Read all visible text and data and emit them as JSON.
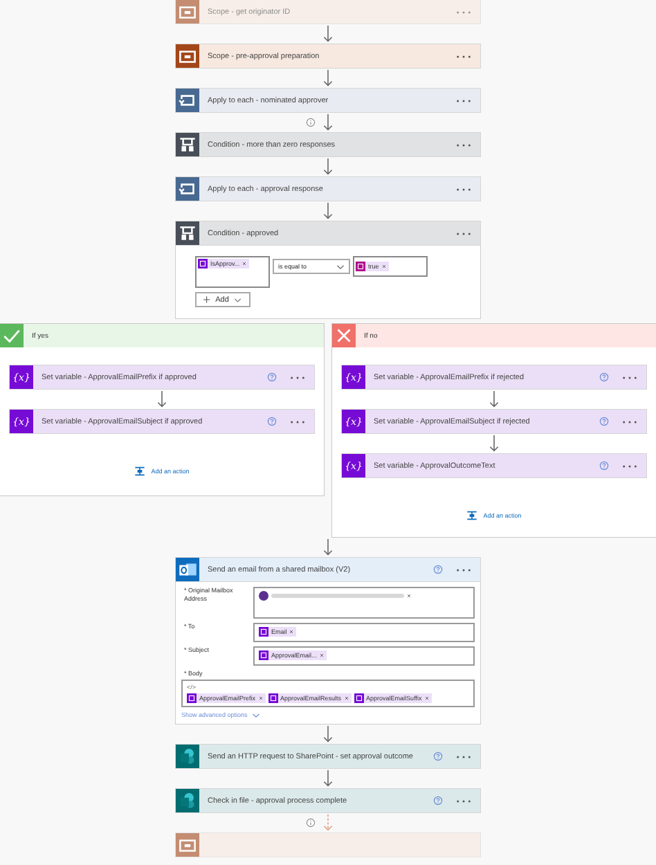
{
  "flow_top": [
    {
      "kind": "scope",
      "title": "Scope - get originator ID",
      "faded": true,
      "arrow": true
    },
    {
      "kind": "scope",
      "title": "Scope - pre-approval preparation",
      "faded": false,
      "arrow": true
    },
    {
      "kind": "foreach",
      "title": "Apply to each - nominated approver",
      "faded": false,
      "arrow": true,
      "info": true
    },
    {
      "kind": "condition",
      "title": "Condition - more than zero responses",
      "faded": false,
      "arrow": true
    },
    {
      "kind": "foreach",
      "title": "Apply to each - approval response",
      "faded": false,
      "arrow": true
    }
  ],
  "condition": {
    "kind": "condition",
    "title": "Condition - approved",
    "left": {
      "kind": "variable",
      "text": "IsApprov..."
    },
    "operator": "is equal to",
    "right": {
      "kind": "expression",
      "text": "true"
    },
    "add_label": "Add"
  },
  "branches": [
    {
      "kind": "yes",
      "title": "If yes",
      "steps": [
        {
          "kind": "variable",
          "icon_label": "{x}",
          "title": "Set variable - ApprovalEmailPrefix if approved",
          "help": true,
          "arrow": true
        },
        {
          "kind": "variable",
          "icon_label": "{x}",
          "title": "Set variable - ApprovalEmailSubject if approved",
          "help": true
        }
      ],
      "add_action": "Add an action"
    },
    {
      "kind": "no",
      "title": "If no",
      "steps": [
        {
          "kind": "variable",
          "icon_label": "{x}",
          "title": "Set variable - ApprovalEmailPrefix if rejected",
          "help": true,
          "arrow": true
        },
        {
          "kind": "variable",
          "icon_label": "{x}",
          "title": "Set variable - ApprovalEmailSubject if rejected",
          "help": true,
          "arrow": true
        },
        {
          "kind": "variable",
          "icon_label": "{x}",
          "title": "Set variable - ApprovalOutcomeText",
          "help": true
        }
      ],
      "add_action": "Add an action"
    }
  ],
  "email": {
    "kind": "outlook",
    "title": "Send an email from a shared mailbox (V2)",
    "help": true,
    "fields": [
      {
        "label": "* Original Mailbox Address",
        "kind": "mailbox",
        "tokens": [
          {
            "kind": "address"
          }
        ]
      },
      {
        "label": "* To",
        "kind": "line",
        "tokens": [
          {
            "kind": "variable",
            "text": "Email"
          }
        ]
      },
      {
        "label": "* Subject",
        "kind": "line",
        "tokens": [
          {
            "kind": "variable",
            "text": "ApprovalEmail..."
          }
        ]
      },
      {
        "label": "* Body",
        "kind": "body",
        "code": "</>",
        "tokens": [
          {
            "kind": "variable",
            "text": "ApprovalEmailPrefix"
          },
          {
            "kind": "variable",
            "text": "ApprovalEmailResults"
          },
          {
            "kind": "variable",
            "text": "ApprovalEmailSuffix"
          }
        ]
      }
    ],
    "advanced": "Show advanced options"
  },
  "flow_bottom": [
    {
      "kind": "sharepoint",
      "title": "Send an HTTP request to SharePoint - set approval outcome",
      "help": true,
      "faded": false,
      "arrow": true
    },
    {
      "kind": "sharepoint",
      "title": "Check in file - approval process complete",
      "help": true,
      "faded": false,
      "arrow": true,
      "info": true,
      "dashed": true
    },
    {
      "kind": "scope",
      "faded": true
    }
  ]
}
